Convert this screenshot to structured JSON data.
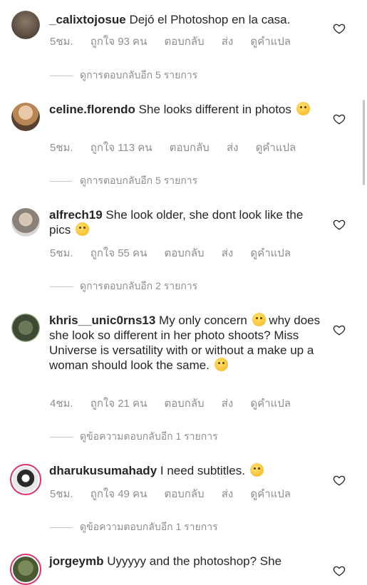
{
  "comments": [
    {
      "username": "_calixtojosue",
      "text": "Dejó el Photoshop en la casa.",
      "time": "5ชม.",
      "likes": "ถูกใจ 93 คน",
      "reply": "ตอบกลับ",
      "send": "ส่ง",
      "translate": "ดูคำแปล",
      "view_replies": "ดูการตอบกลับอีก 5 รายการ",
      "emoji": ""
    },
    {
      "username": "celine.florendo",
      "text": "She looks different in photos",
      "time": "5ชม.",
      "likes": "ถูกใจ 113 คน",
      "reply": "ตอบกลับ",
      "send": "ส่ง",
      "translate": "ดูคำแปล",
      "view_replies": "ดูการตอบกลับอีก 5 รายการ",
      "emoji": "flushed-face"
    },
    {
      "username": "alfrech19",
      "text": "She look older, she dont look like the pics",
      "time": "5ชม.",
      "likes": "ถูกใจ 55 คน",
      "reply": "ตอบกลับ",
      "send": "ส่ง",
      "translate": "ดูคำแปล",
      "view_replies": "ดูการตอบกลับอีก 2 รายการ",
      "emoji": "crying-face"
    },
    {
      "username": "khris__unic0rns13",
      "text": "My only concern",
      "text2": "why does she look so different in her photo shoots? Miss Universe is versatility with or without a make up a woman should look the same.",
      "time": "4ชม.",
      "likes": "ถูกใจ 21 คน",
      "reply": "ตอบกลับ",
      "send": "ส่ง",
      "translate": "ดูคำแปล",
      "view_replies": "ดูข้อความตอบกลับอีก 1 รายการ",
      "emoji": "hushed-face",
      "emoji2": "thinking-face"
    },
    {
      "username": "dharukusumahady",
      "text": "I need subtitles.",
      "time": "5ชม.",
      "likes": "ถูกใจ 49 คน",
      "reply": "ตอบกลับ",
      "send": "ส่ง",
      "translate": "ดูคำแปล",
      "view_replies": "ดูข้อความตอบกลับอีก 1 รายการ",
      "emoji": "slightly-smiling-face"
    },
    {
      "username": "jorgeymb",
      "text": "Uyyyyy and the photoshop? She"
    }
  ],
  "colors": {
    "text": "#262626",
    "meta": "#8e8e8e",
    "story_ring": "#e1306c"
  },
  "icons": {
    "like": "heart-outline-icon"
  }
}
